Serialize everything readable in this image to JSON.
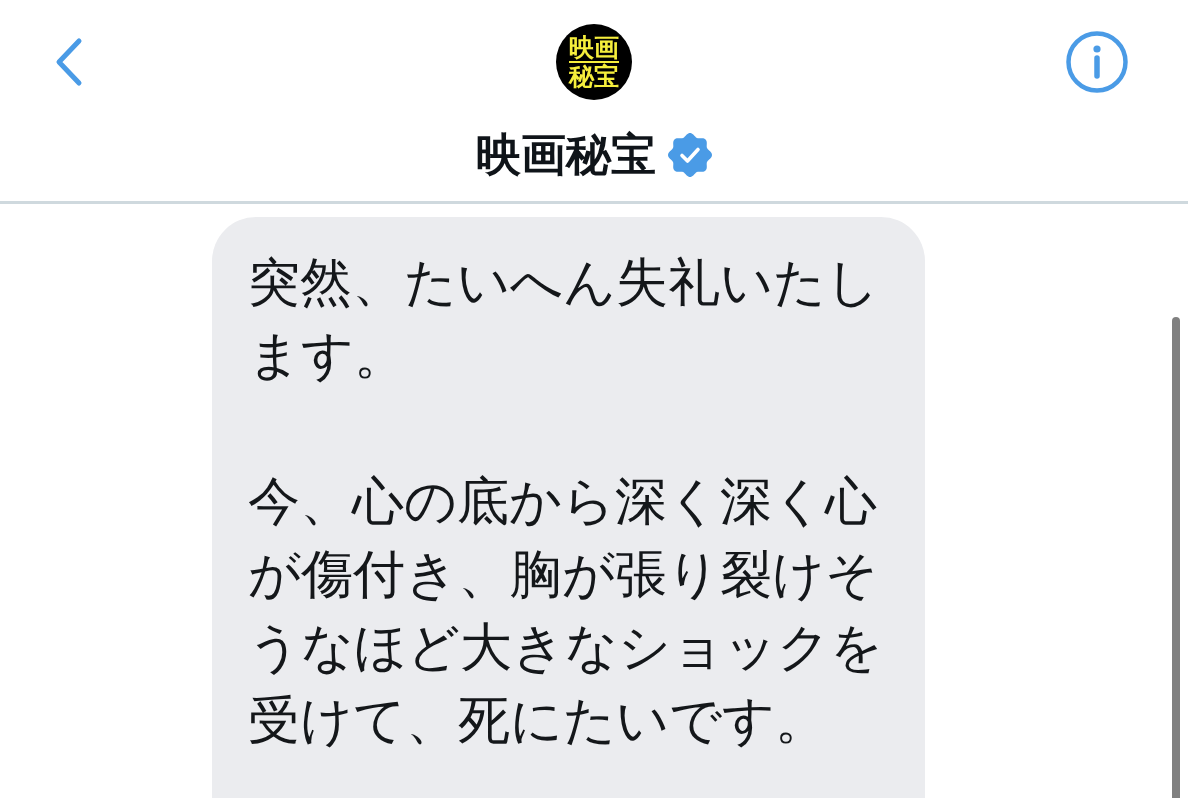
{
  "header": {
    "avatar_logo": [
      "映画",
      "秘宝"
    ],
    "title": "映画秘宝",
    "verified": true
  },
  "messages": [
    {
      "kind": "received",
      "paragraphs": [
        [
          "突然、たいへん失礼いたし",
          "ます。"
        ],
        [
          "今、心の底から深く深く心",
          "が傷付き、胸が張り裂けそ",
          "うなほど大きなショックを",
          "受けて、死にたいです。"
        ]
      ]
    }
  ]
}
